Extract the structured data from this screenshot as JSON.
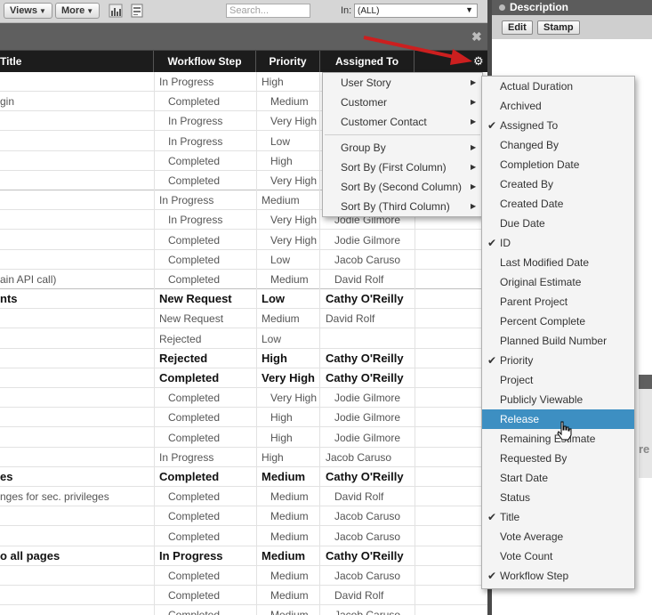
{
  "toolbar": {
    "views_label": "Views",
    "more_label": "More",
    "search_placeholder": "Search...",
    "in_label": "In:",
    "in_value": "(ALL)"
  },
  "columns": [
    "Title",
    "Workflow Step",
    "Priority",
    "Assigned To"
  ],
  "rows": [
    {
      "title": "",
      "step": "In Progress",
      "priority": "High",
      "assigned": "",
      "bold": false,
      "indent": false
    },
    {
      "title": "gin",
      "step": "Completed",
      "priority": "Medium",
      "assigned": "",
      "bold": false,
      "indent": true
    },
    {
      "title": "",
      "step": "In Progress",
      "priority": "Very High",
      "assigned": "",
      "bold": false,
      "indent": true
    },
    {
      "title": "",
      "step": "In Progress",
      "priority": "Low",
      "assigned": "",
      "bold": false,
      "indent": true
    },
    {
      "title": "",
      "step": "Completed",
      "priority": "High",
      "assigned": "",
      "bold": false,
      "indent": true
    },
    {
      "title": "",
      "step": "Completed",
      "priority": "Very High",
      "assigned": "",
      "bold": false,
      "indent": true
    },
    {
      "title": "",
      "step": "In Progress",
      "priority": "Medium",
      "assigned": "",
      "bold": false,
      "indent": false
    },
    {
      "title": "",
      "step": "In Progress",
      "priority": "Very High",
      "assigned": "Jodie Gilmore",
      "bold": false,
      "indent": true
    },
    {
      "title": "",
      "step": "Completed",
      "priority": "Very High",
      "assigned": "Jodie Gilmore",
      "bold": false,
      "indent": true
    },
    {
      "title": "",
      "step": "Completed",
      "priority": "Low",
      "assigned": "Jacob Caruso",
      "bold": false,
      "indent": true
    },
    {
      "title": "ain API call)",
      "step": "Completed",
      "priority": "Medium",
      "assigned": "David Rolf",
      "bold": false,
      "indent": true
    },
    {
      "title": "nts",
      "step": "New Request",
      "priority": "Low",
      "assigned": "Cathy O'Reilly",
      "bold": true,
      "indent": false
    },
    {
      "title": "",
      "step": "New Request",
      "priority": "Medium",
      "assigned": "David Rolf",
      "bold": false,
      "indent": false
    },
    {
      "title": "",
      "step": "Rejected",
      "priority": "Low",
      "assigned": "",
      "bold": false,
      "indent": false
    },
    {
      "title": "",
      "step": "Rejected",
      "priority": "High",
      "assigned": "Cathy O'Reilly",
      "bold": true,
      "indent": false
    },
    {
      "title": "",
      "step": "Completed",
      "priority": "Very High",
      "assigned": "Cathy O'Reilly",
      "bold": true,
      "indent": false
    },
    {
      "title": "",
      "step": "Completed",
      "priority": "Very High",
      "assigned": "Jodie Gilmore",
      "bold": false,
      "indent": true
    },
    {
      "title": "",
      "step": "Completed",
      "priority": "High",
      "assigned": "Jodie Gilmore",
      "bold": false,
      "indent": true
    },
    {
      "title": "",
      "step": "Completed",
      "priority": "High",
      "assigned": "Jodie Gilmore",
      "bold": false,
      "indent": true
    },
    {
      "title": "",
      "step": "In Progress",
      "priority": "High",
      "assigned": "Jacob Caruso",
      "bold": false,
      "indent": false
    },
    {
      "title": "es",
      "step": "Completed",
      "priority": "Medium",
      "assigned": "Cathy O'Reilly",
      "bold": true,
      "indent": false
    },
    {
      "title": "nges for sec. privileges",
      "step": "Completed",
      "priority": "Medium",
      "assigned": "David Rolf",
      "bold": false,
      "indent": true
    },
    {
      "title": "",
      "step": "Completed",
      "priority": "Medium",
      "assigned": "Jacob Caruso",
      "bold": false,
      "indent": true
    },
    {
      "title": "",
      "step": "Completed",
      "priority": "Medium",
      "assigned": "Jacob Caruso",
      "bold": false,
      "indent": true
    },
    {
      "title": "o all pages",
      "step": "In Progress",
      "priority": "Medium",
      "assigned": "Cathy O'Reilly",
      "bold": true,
      "indent": false
    },
    {
      "title": "",
      "step": "Completed",
      "priority": "Medium",
      "assigned": "Jacob Caruso",
      "bold": false,
      "indent": true
    },
    {
      "title": "",
      "step": "Completed",
      "priority": "Medium",
      "assigned": "David Rolf",
      "bold": false,
      "indent": true
    },
    {
      "title": "",
      "step": "Completed",
      "priority": "Medium",
      "assigned": "Jacob Caruso",
      "bold": false,
      "indent": true
    }
  ],
  "description": {
    "title": "Description",
    "edit_label": "Edit",
    "stamp_label": "Stamp",
    "partial_text": "re"
  },
  "context_menu": [
    {
      "label": "User Story",
      "submenu": true
    },
    {
      "label": "Customer",
      "submenu": true
    },
    {
      "label": "Customer Contact",
      "submenu": true
    },
    {
      "label": "Group By",
      "submenu": true
    },
    {
      "label": "Sort By (First Column)",
      "submenu": true
    },
    {
      "label": "Sort By (Second Column)",
      "submenu": true
    },
    {
      "label": "Sort By (Third Column)",
      "submenu": true
    }
  ],
  "field_menu": [
    {
      "label": "Actual Duration",
      "checked": false
    },
    {
      "label": "Archived",
      "checked": false
    },
    {
      "label": "Assigned To",
      "checked": true
    },
    {
      "label": "Changed By",
      "checked": false
    },
    {
      "label": "Completion Date",
      "checked": false
    },
    {
      "label": "Created By",
      "checked": false
    },
    {
      "label": "Created Date",
      "checked": false
    },
    {
      "label": "Due Date",
      "checked": false
    },
    {
      "label": "ID",
      "checked": true
    },
    {
      "label": "Last Modified Date",
      "checked": false
    },
    {
      "label": "Original Estimate",
      "checked": false
    },
    {
      "label": "Parent Project",
      "checked": false
    },
    {
      "label": "Percent Complete",
      "checked": false
    },
    {
      "label": "Planned Build Number",
      "checked": false
    },
    {
      "label": "Priority",
      "checked": true
    },
    {
      "label": "Project",
      "checked": false
    },
    {
      "label": "Publicly Viewable",
      "checked": false
    },
    {
      "label": "Release",
      "checked": false,
      "highlighted": true
    },
    {
      "label": "Remaining Estimate",
      "checked": false
    },
    {
      "label": "Requested By",
      "checked": false
    },
    {
      "label": "Start Date",
      "checked": false
    },
    {
      "label": "Status",
      "checked": false
    },
    {
      "label": "Title",
      "checked": true
    },
    {
      "label": "Vote Average",
      "checked": false
    },
    {
      "label": "Vote Count",
      "checked": false
    },
    {
      "label": "Workflow Step",
      "checked": true
    }
  ],
  "colors": {
    "header_bg": "#1c1c1c",
    "highlight": "#3d8fc2",
    "arrow": "#cc1f1f"
  }
}
